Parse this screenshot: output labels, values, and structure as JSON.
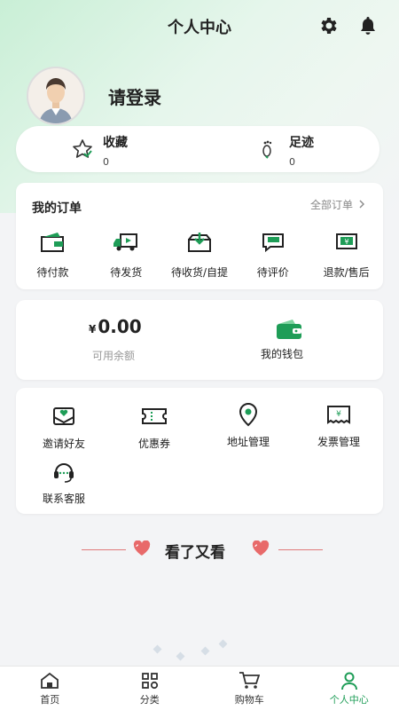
{
  "header": {
    "title": "个人中心",
    "settings_icon": "gear-icon",
    "notify_icon": "bell-icon"
  },
  "profile": {
    "login_text": "请登录",
    "avatar_icon": "user-avatar"
  },
  "favorites": [
    {
      "label": "收藏",
      "count": "0",
      "icon": "star-icon"
    },
    {
      "label": "足迹",
      "count": "0",
      "icon": "footprint-icon"
    }
  ],
  "orders": {
    "title": "我的订单",
    "all_label": "全部订单",
    "items": [
      {
        "label": "待付款",
        "icon": "wallet-pay-icon"
      },
      {
        "label": "待发货",
        "icon": "truck-icon"
      },
      {
        "label": "待收货/自提",
        "icon": "package-icon"
      },
      {
        "label": "待评价",
        "icon": "comment-icon"
      },
      {
        "label": "退款/售后",
        "icon": "refund-icon"
      }
    ]
  },
  "wallet": {
    "currency": "¥",
    "amount": "0.00",
    "balance_label": "可用余额",
    "wallet_label": "我的钱包"
  },
  "services": [
    {
      "label": "邀请好友",
      "icon": "invite-icon"
    },
    {
      "label": "优惠券",
      "icon": "coupon-icon"
    },
    {
      "label": "地址管理",
      "icon": "location-icon"
    },
    {
      "label": "发票管理",
      "icon": "invoice-icon"
    },
    {
      "label": "联系客服",
      "icon": "headset-icon"
    }
  ],
  "recommend": {
    "title": "看了又看"
  },
  "tabs": [
    {
      "label": "首页",
      "icon": "home-icon"
    },
    {
      "label": "分类",
      "icon": "category-icon"
    },
    {
      "label": "购物车",
      "icon": "cart-icon"
    },
    {
      "label": "个人中心",
      "icon": "profile-icon",
      "active": true
    }
  ],
  "colors": {
    "accent": "#1e9d57",
    "heart": "#e86a6a"
  }
}
